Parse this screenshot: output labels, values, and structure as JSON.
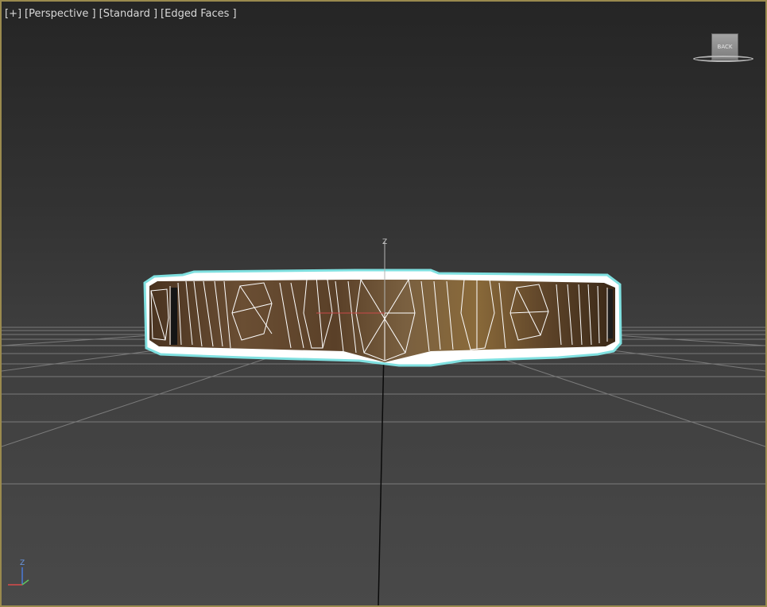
{
  "viewport": {
    "labels": {
      "plus": "[+]",
      "view": "[Perspective ]",
      "shading": "[Standard ]",
      "style": "[Edged Faces ]"
    },
    "frame_color": "#9a8a4e",
    "background_top": "#252525",
    "background_bottom": "#494949"
  },
  "viewcube": {
    "face_label": "BACK"
  },
  "scene": {
    "object": "ring",
    "selection_color": "#7fe0e0",
    "wire_color": "#ffffff",
    "gizmo_axis_label": "Z"
  },
  "axis_tripod": {
    "z_label": "Z",
    "z_color": "#4a7ad8",
    "x_color": "#d84a4a",
    "y_color": "#5fc45f"
  }
}
